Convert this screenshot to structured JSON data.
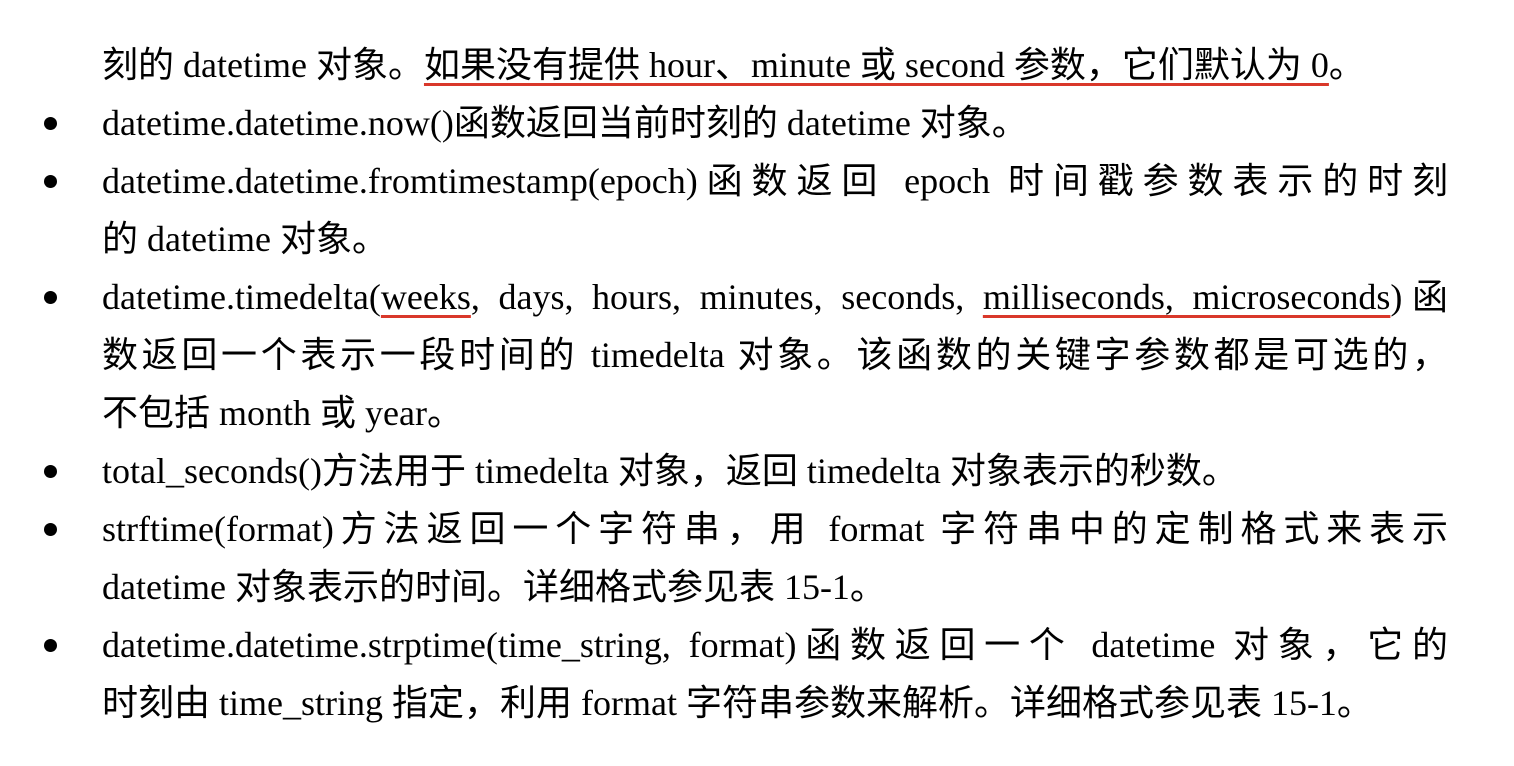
{
  "colors": {
    "text": "#000000",
    "underline": "#d9382a"
  },
  "lines": [
    {
      "segments": [
        {
          "text": "刻的 datetime 对象。",
          "underline": false
        },
        {
          "text": "如果没有提供 hour、minute 或 second 参数，它们默认为 0",
          "underline": true
        },
        {
          "text": "。",
          "underline": false
        }
      ]
    },
    {
      "bullet": true,
      "segments": [
        {
          "text": "datetime.datetime.now()函数返回当前时刻的 datetime 对象。",
          "underline": false
        }
      ]
    },
    {
      "bullet": true,
      "justify": true,
      "segments": [
        {
          "text": "datetime.datetime.fromtimestamp(epoch)函数返回 epoch 时间戳参数表示的时刻",
          "underline": false
        }
      ]
    },
    {
      "segments": [
        {
          "text": "的 datetime 对象。",
          "underline": false
        }
      ]
    },
    {
      "bullet": true,
      "justify": true,
      "segments": [
        {
          "text": "datetime.timedelta(",
          "underline": false
        },
        {
          "text": "weeks",
          "underline": true
        },
        {
          "text": ", days, hours, minutes, seconds, ",
          "underline": false
        },
        {
          "text": "milliseconds, microseconds",
          "underline": true
        },
        {
          "text": ")函",
          "underline": false
        }
      ]
    },
    {
      "justify": true,
      "segments": [
        {
          "text": "数返回一个表示一段时间的 timedelta 对象。该函数的关键字参数都是可选的，",
          "underline": false
        }
      ]
    },
    {
      "segments": [
        {
          "text": "不包括 month 或 year。",
          "underline": false
        }
      ]
    },
    {
      "bullet": true,
      "segments": [
        {
          "text": "total_seconds()方法用于 timedelta 对象，返回 timedelta 对象表示的秒数。",
          "underline": false
        }
      ]
    },
    {
      "bullet": true,
      "justify": true,
      "segments": [
        {
          "text": "strftime(format)方法返回一个字符串，用 format 字符串中的定制格式来表示",
          "underline": false
        }
      ]
    },
    {
      "segments": [
        {
          "text": "datetime 对象表示的时间。详细格式参见表 15-1。",
          "underline": false
        }
      ]
    },
    {
      "bullet": true,
      "justify": true,
      "segments": [
        {
          "text": "datetime.datetime.strptime(time_string, format)函数返回一个 datetime 对象，它的",
          "underline": false
        }
      ]
    },
    {
      "segments": [
        {
          "text": "时刻由 time_string 指定，利用 format 字符串参数来解析。详细格式参见表 15-1。",
          "underline": false
        }
      ]
    }
  ]
}
